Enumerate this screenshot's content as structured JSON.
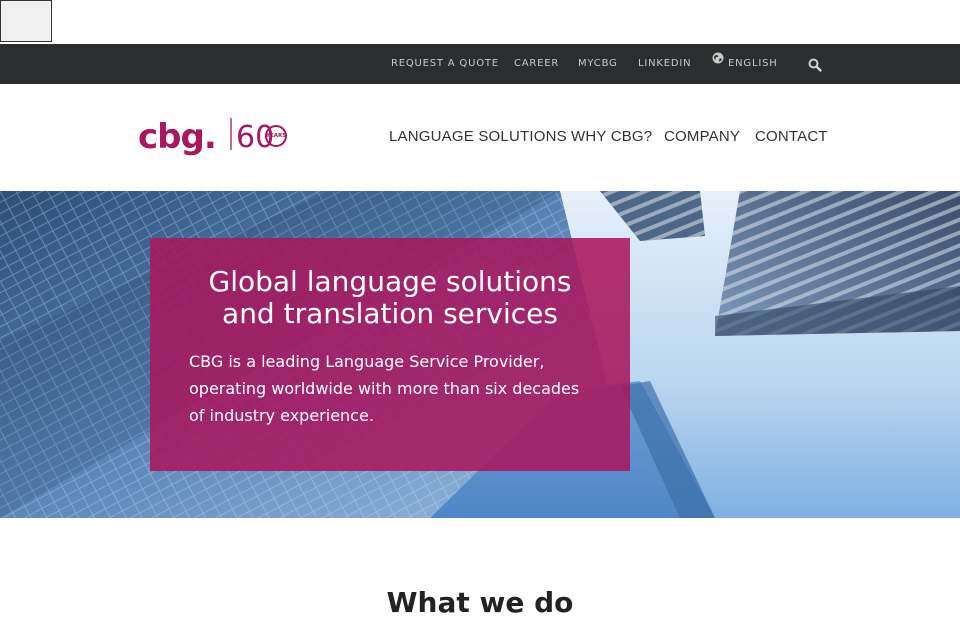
{
  "colors": {
    "brand": "#a8175f",
    "topbar": "#2b2d2f",
    "hero_sky": "#cfe3f5"
  },
  "topbar": {
    "links": [
      {
        "label": "REQUEST A QUOTE"
      },
      {
        "label": "CAREER"
      },
      {
        "label": "MYCBG"
      },
      {
        "label": "LINKEDIN"
      }
    ],
    "language": "ENGLISH",
    "language_icon": "globe-icon",
    "search_icon": "search-icon"
  },
  "brand": {
    "name": "cbg.",
    "anniversary": "60",
    "years": "YEARS"
  },
  "nav": {
    "items": [
      {
        "label": "LANGUAGE SOLUTIONS"
      },
      {
        "label": "WHY CBG?"
      },
      {
        "label": "COMPANY"
      },
      {
        "label": "CONTACT"
      }
    ]
  },
  "hero": {
    "title_line1": "Global language solutions",
    "title_line2": "and translation services",
    "description": "CBG is a leading Language Service Provider, operating worldwide with more than six decades of industry experience."
  },
  "section": {
    "title": "What we do"
  }
}
